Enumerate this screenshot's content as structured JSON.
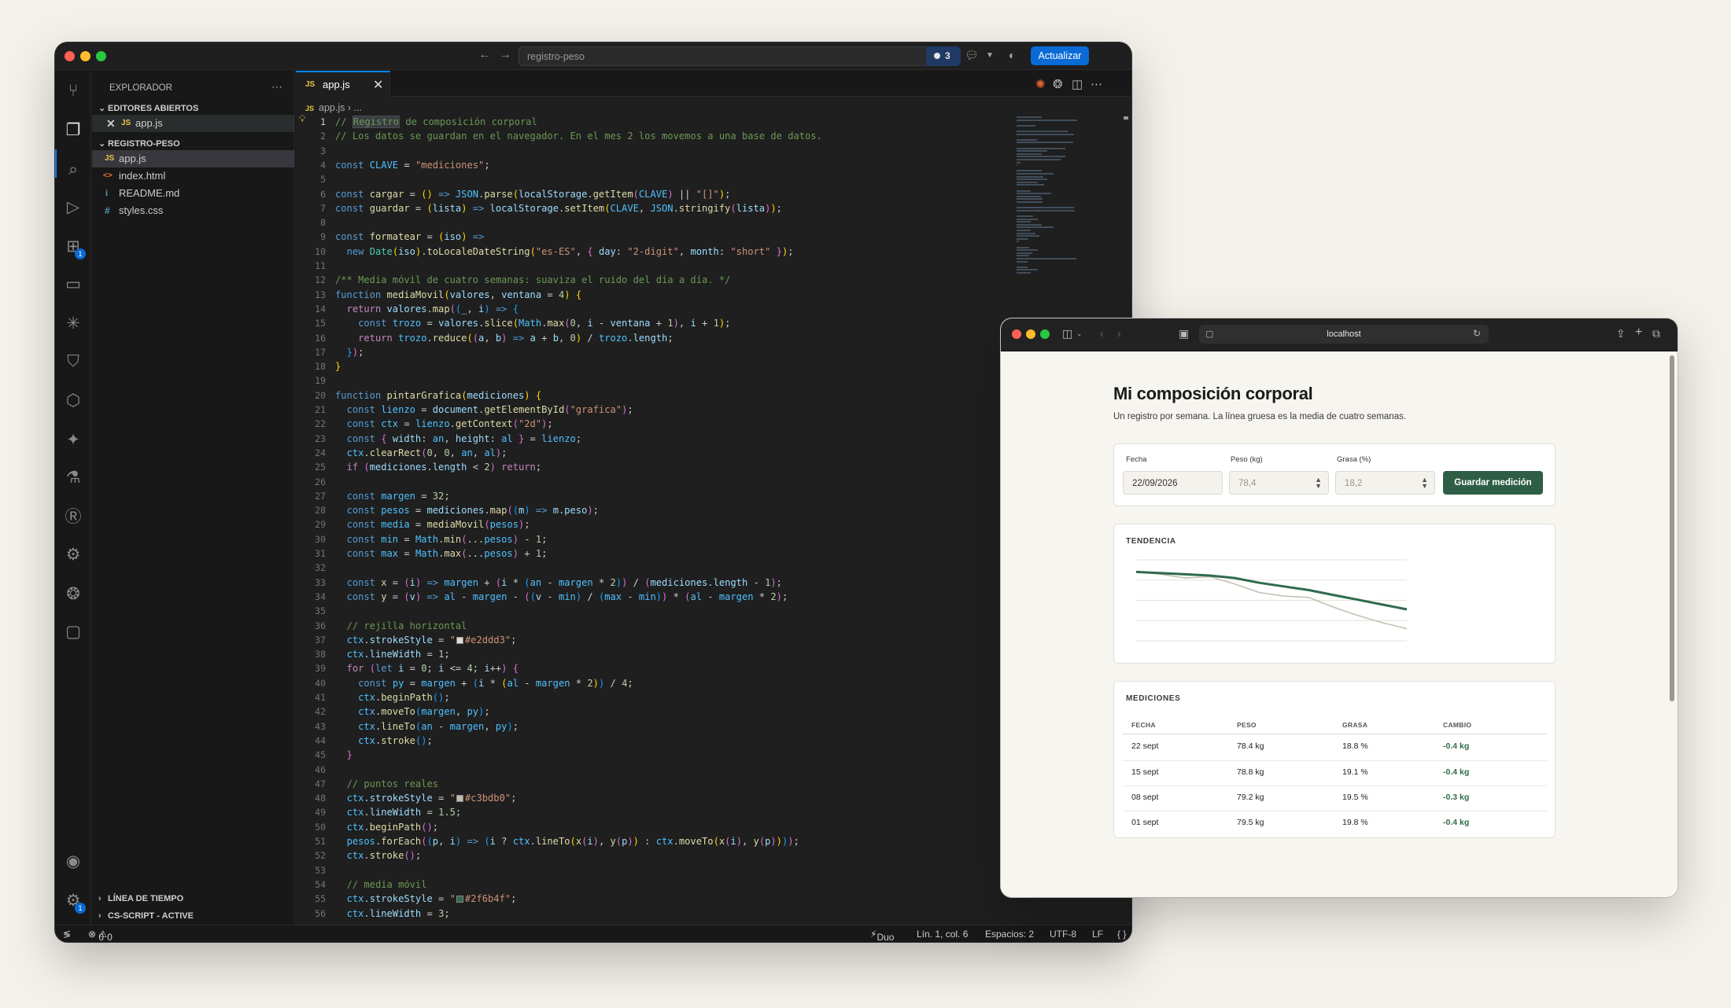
{
  "vscode": {
    "search": "registro-peso",
    "badge_count": "3",
    "update_label": "Actualizar",
    "activity_badges": [
      "1",
      "1"
    ],
    "explorer": {
      "title": "EXPLORADOR",
      "open_editors_label": "EDITORES ABIERTOS",
      "open_editors": [
        {
          "icon": "JS",
          "name": "app.js"
        }
      ],
      "folder_label": "REGISTRO-PESO",
      "files": [
        {
          "icon": "JS",
          "name": "app.js",
          "color": "#e8c547"
        },
        {
          "icon": "<>",
          "name": "index.html",
          "color": "#e37933"
        },
        {
          "icon": "i",
          "name": "README.md",
          "color": "#519aba"
        },
        {
          "icon": "#",
          "name": "styles.css",
          "color": "#519aba"
        }
      ],
      "timeline_label": "LÍNEA DE TIEMPO",
      "cs_label": "CS-SCRIPT - ACTIVE"
    },
    "tab": {
      "icon": "JS",
      "name": "app.js"
    },
    "breadcrumb": {
      "file": "app.js",
      "rest": "..."
    },
    "status": {
      "errors": "0",
      "warnings": "0",
      "copilot": "Duo",
      "position": "Lín. 1, col. 6",
      "spaces": "Espacios: 2",
      "encoding": "UTF-8",
      "eol": "LF",
      "lang": "{ }"
    },
    "current_line": 1,
    "code_lines": [
      "<span class=\"c\">// </span><span class=\"c hl\">Registro</span><span class=\"c\"> de composición corporal</span>",
      "<span class=\"c\">// Los datos se guardan en el navegador. En el mes 2 los movemos a una base de datos.</span>",
      "",
      "<span class=\"k\">const</span> <span class=\"cn\">CLAVE</span> <span class=\"p\">=</span> <span class=\"s\">\"mediciones\"</span>;",
      "",
      "<span class=\"k\">const</span> <span class=\"f\">cargar</span> = <span class=\"b1\">()</span> <span class=\"k\">=&gt;</span> <span class=\"cn\">JSON</span>.<span class=\"f\">parse</span><span class=\"b1\">(</span><span class=\"v\">localStorage</span>.<span class=\"f\">getItem</span><span class=\"b2\">(</span><span class=\"cn\">CLAVE</span><span class=\"b2\">)</span> || <span class=\"s\">\"[]\"</span><span class=\"b1\">)</span>;",
      "<span class=\"k\">const</span> <span class=\"f\">guardar</span> = <span class=\"b1\">(</span><span class=\"v\">lista</span><span class=\"b1\">)</span> <span class=\"k\">=&gt;</span> <span class=\"v\">localStorage</span>.<span class=\"f\">setItem</span><span class=\"b1\">(</span><span class=\"cn\">CLAVE</span>, <span class=\"cn\">JSON</span>.<span class=\"f\">stringify</span><span class=\"b2\">(</span><span class=\"v\">lista</span><span class=\"b2\">)</span><span class=\"b1\">)</span>;",
      "",
      "<span class=\"k\">const</span> <span class=\"f\">formatear</span> = <span class=\"b1\">(</span><span class=\"v\">iso</span><span class=\"b1\">)</span> <span class=\"k\">=&gt;</span>",
      "  <span class=\"k\">new</span> <span class=\"t\">Date</span><span class=\"b1\">(</span><span class=\"v\">iso</span><span class=\"b1\">)</span>.<span class=\"f\">toLocaleDateString</span><span class=\"b1\">(</span><span class=\"s\">\"es-ES\"</span>, <span class=\"b2\">{</span> <span class=\"v\">day</span>: <span class=\"s\">\"2-digit\"</span>, <span class=\"v\">month</span>: <span class=\"s\">\"short\"</span> <span class=\"b2\">}</span><span class=\"b1\">)</span>;",
      "",
      "<span class=\"c\">/** Media móvil de cuatro semanas: suaviza el ruido del día a día. */</span>",
      "<span class=\"k\">function</span> <span class=\"f\">mediaMovil</span><span class=\"b1\">(</span><span class=\"v\">valores</span>, <span class=\"v\">ventana</span> = <span class=\"n\">4</span><span class=\"b1\">)</span> <span class=\"b1\">{</span>",
      "  <span class=\"kc\">return</span> <span class=\"v\">valores</span>.<span class=\"f\">map</span><span class=\"b2\">(</span><span class=\"b3\">(</span><span class=\"v\">_</span>, <span class=\"v\">i</span><span class=\"b3\">)</span> <span class=\"k\">=&gt;</span> <span class=\"b3\">{</span>",
      "    <span class=\"k\">const</span> <span class=\"cn\">trozo</span> = <span class=\"v\">valores</span>.<span class=\"f\">slice</span><span class=\"b1\">(</span><span class=\"cn\">Math</span>.<span class=\"f\">max</span><span class=\"b2\">(</span><span class=\"n\">0</span>, <span class=\"v\">i</span> - <span class=\"v\">ventana</span> + <span class=\"n\">1</span><span class=\"b2\">)</span>, <span class=\"v\">i</span> + <span class=\"n\">1</span><span class=\"b1\">)</span>;",
      "    <span class=\"kc\">return</span> <span class=\"cn\">trozo</span>.<span class=\"f\">reduce</span><span class=\"b1\">(</span><span class=\"b2\">(</span><span class=\"v\">a</span>, <span class=\"v\">b</span><span class=\"b2\">)</span> <span class=\"k\">=&gt;</span> <span class=\"v\">a</span> + <span class=\"v\">b</span>, <span class=\"n\">0</span><span class=\"b1\">)</span> / <span class=\"cn\">trozo</span>.<span class=\"v\">length</span>;",
      "  <span class=\"b3\">}</span><span class=\"b2\">)</span>;",
      "<span class=\"b1\">}</span>",
      "",
      "<span class=\"k\">function</span> <span class=\"f\">pintarGrafica</span><span class=\"b1\">(</span><span class=\"v\">mediciones</span><span class=\"b1\">)</span> <span class=\"b1\">{</span>",
      "  <span class=\"k\">const</span> <span class=\"cn\">lienzo</span> = <span class=\"v\">document</span>.<span class=\"f\">getElementById</span><span class=\"b2\">(</span><span class=\"s\">\"grafica\"</span><span class=\"b2\">)</span>;",
      "  <span class=\"k\">const</span> <span class=\"cn\">ctx</span> = <span class=\"cn\">lienzo</span>.<span class=\"f\">getContext</span><span class=\"b2\">(</span><span class=\"s\">\"2d\"</span><span class=\"b2\">)</span>;",
      "  <span class=\"k\">const</span> <span class=\"b2\">{</span> <span class=\"v\">width</span>: <span class=\"cn\">an</span>, <span class=\"v\">height</span>: <span class=\"cn\">al</span> <span class=\"b2\">}</span> = <span class=\"cn\">lienzo</span>;",
      "  <span class=\"cn\">ctx</span>.<span class=\"f\">clearRect</span><span class=\"b2\">(</span><span class=\"n\">0</span>, <span class=\"n\">0</span>, <span class=\"cn\">an</span>, <span class=\"cn\">al</span><span class=\"b2\">)</span>;",
      "  <span class=\"kc\">if</span> <span class=\"b2\">(</span><span class=\"v\">mediciones</span>.<span class=\"v\">length</span> &lt; <span class=\"n\">2</span><span class=\"b2\">)</span> <span class=\"kc\">return</span>;",
      "",
      "  <span class=\"k\">const</span> <span class=\"cn\">margen</span> = <span class=\"n\">32</span>;",
      "  <span class=\"k\">const</span> <span class=\"cn\">pesos</span> = <span class=\"v\">mediciones</span>.<span class=\"f\">map</span><span class=\"b2\">(</span><span class=\"b3\">(</span><span class=\"v\">m</span><span class=\"b3\">)</span> <span class=\"k\">=&gt;</span> <span class=\"v\">m</span>.<span class=\"v\">peso</span><span class=\"b2\">)</span>;",
      "  <span class=\"k\">const</span> <span class=\"cn\">media</span> = <span class=\"f\">mediaMovil</span><span class=\"b2\">(</span><span class=\"cn\">pesos</span><span class=\"b2\">)</span>;",
      "  <span class=\"k\">const</span> <span class=\"cn\">min</span> = <span class=\"cn\">Math</span>.<span class=\"f\">min</span><span class=\"b2\">(</span>...<span class=\"cn\">pesos</span><span class=\"b2\">)</span> - <span class=\"n\">1</span>;",
      "  <span class=\"k\">const</span> <span class=\"cn\">max</span> = <span class=\"cn\">Math</span>.<span class=\"f\">max</span><span class=\"b2\">(</span>...<span class=\"cn\">pesos</span><span class=\"b2\">)</span> + <span class=\"n\">1</span>;",
      "",
      "  <span class=\"k\">const</span> <span class=\"f\">x</span> = <span class=\"b2\">(</span><span class=\"v\">i</span><span class=\"b2\">)</span> <span class=\"k\">=&gt;</span> <span class=\"cn\">margen</span> + <span class=\"b2\">(</span><span class=\"v\">i</span> * <span class=\"b3\">(</span><span class=\"cn\">an</span> - <span class=\"cn\">margen</span> * <span class=\"n\">2</span><span class=\"b3\">)</span><span class=\"b2\">)</span> / <span class=\"b2\">(</span><span class=\"v\">mediciones</span>.<span class=\"v\">length</span> - <span class=\"n\">1</span><span class=\"b2\">)</span>;",
      "  <span class=\"k\">const</span> <span class=\"f\">y</span> = <span class=\"b2\">(</span><span class=\"v\">v</span><span class=\"b2\">)</span> <span class=\"k\">=&gt;</span> <span class=\"cn\">al</span> - <span class=\"cn\">margen</span> - <span class=\"b2\">(</span><span class=\"b3\">(</span><span class=\"v\">v</span> - <span class=\"cn\">min</span><span class=\"b3\">)</span> / <span class=\"b3\">(</span><span class=\"cn\">max</span> - <span class=\"cn\">min</span><span class=\"b3\">)</span><span class=\"b2\">)</span> * <span class=\"b2\">(</span><span class=\"cn\">al</span> - <span class=\"cn\">margen</span> * <span class=\"n\">2</span><span class=\"b2\">)</span>;",
      "",
      "  <span class=\"c\">// rejilla horizontal</span>",
      "  <span class=\"cn\">ctx</span>.<span class=\"v\">strokeStyle</span> = <span class=\"s\">\"<span class=\"sw\" style=\"background:#e2ddd3\"></span>#e2ddd3\"</span>;",
      "  <span class=\"cn\">ctx</span>.<span class=\"v\">lineWidth</span> = <span class=\"n\">1</span>;",
      "  <span class=\"kc\">for</span> <span class=\"b2\">(</span><span class=\"k\">let</span> <span class=\"v\">i</span> = <span class=\"n\">0</span>; <span class=\"v\">i</span> &lt;= <span class=\"n\">4</span>; <span class=\"v\">i</span>++<span class=\"b2\">)</span> <span class=\"b2\">{</span>",
      "    <span class=\"k\">const</span> <span class=\"cn\">py</span> = <span class=\"cn\">margen</span> + <span class=\"b3\">(</span><span class=\"v\">i</span> * <span class=\"b1\">(</span><span class=\"cn\">al</span> - <span class=\"cn\">margen</span> * <span class=\"n\">2</span><span class=\"b1\">)</span><span class=\"b3\">)</span> / <span class=\"n\">4</span>;",
      "    <span class=\"cn\">ctx</span>.<span class=\"f\">beginPath</span><span class=\"b3\">()</span>;",
      "    <span class=\"cn\">ctx</span>.<span class=\"f\">moveTo</span><span class=\"b3\">(</span><span class=\"cn\">margen</span>, <span class=\"cn\">py</span><span class=\"b3\">)</span>;",
      "    <span class=\"cn\">ctx</span>.<span class=\"f\">lineTo</span><span class=\"b3\">(</span><span class=\"cn\">an</span> - <span class=\"cn\">margen</span>, <span class=\"cn\">py</span><span class=\"b3\">)</span>;",
      "    <span class=\"cn\">ctx</span>.<span class=\"f\">stroke</span><span class=\"b3\">()</span>;",
      "  <span class=\"b2\">}</span>",
      "",
      "  <span class=\"c\">// puntos reales</span>",
      "  <span class=\"cn\">ctx</span>.<span class=\"v\">strokeStyle</span> = <span class=\"s\">\"<span class=\"sw\" style=\"background:#c3bdb0\"></span>#c3bdb0\"</span>;",
      "  <span class=\"cn\">ctx</span>.<span class=\"v\">lineWidth</span> = <span class=\"n\">1.5</span>;",
      "  <span class=\"cn\">ctx</span>.<span class=\"f\">beginPath</span><span class=\"b2\">()</span>;",
      "  <span class=\"cn\">pesos</span>.<span class=\"f\">forEach</span><span class=\"b2\">(</span><span class=\"b3\">(</span><span class=\"v\">p</span>, <span class=\"v\">i</span><span class=\"b3\">)</span> <span class=\"k\">=&gt;</span> <span class=\"b3\">(</span><span class=\"v\">i</span> ? <span class=\"cn\">ctx</span>.<span class=\"f\">lineTo</span><span class=\"b1\">(</span><span class=\"f\">x</span><span class=\"b2\">(</span><span class=\"v\">i</span><span class=\"b2\">)</span>, <span class=\"f\">y</span><span class=\"b2\">(</span><span class=\"v\">p</span><span class=\"b2\">)</span><span class=\"b1\">)</span> : <span class=\"cn\">ctx</span>.<span class=\"f\">moveTo</span><span class=\"b1\">(</span><span class=\"f\">x</span><span class=\"b2\">(</span><span class=\"v\">i</span><span class=\"b2\">)</span>, <span class=\"f\">y</span><span class=\"b2\">(</span><span class=\"v\">p</span><span class=\"b2\">)</span><span class=\"b1\">)</span><span class=\"b3\">)</span><span class=\"b2\">)</span>;",
      "  <span class=\"cn\">ctx</span>.<span class=\"f\">stroke</span><span class=\"b2\">()</span>;",
      "",
      "  <span class=\"c\">// media móvil</span>",
      "  <span class=\"cn\">ctx</span>.<span class=\"v\">strokeStyle</span> = <span class=\"s\">\"<span class=\"sw\" style=\"background:#2f6b4f\"></span>#2f6b4f\"</span>;",
      "  <span class=\"cn\">ctx</span>.<span class=\"v\">lineWidth</span> = <span class=\"n\">3</span>;"
    ]
  },
  "browser": {
    "url": "localhost",
    "title": "Mi composición corporal",
    "subtitle": "Un registro por semana. La línea gruesa es la media de cuatro semanas.",
    "form": {
      "date_label": "Fecha",
      "date_value": "22/09/2026",
      "weight_label": "Peso (kg)",
      "weight_placeholder": "78,4",
      "fat_label": "Grasa (%)",
      "fat_placeholder": "18,2",
      "save_label": "Guardar medición"
    },
    "trend_title": "TENDENCIA",
    "table_title": "MEDICIONES",
    "columns": [
      "FECHA",
      "PESO",
      "GRASA",
      "CAMBIO"
    ],
    "rows": [
      [
        "22 sept",
        "78.4 kg",
        "18.8 %",
        "-0.4 kg"
      ],
      [
        "15 sept",
        "78.8 kg",
        "19.1 %",
        "-0.4 kg"
      ],
      [
        "08 sept",
        "79.2 kg",
        "19.5 %",
        "-0.3 kg"
      ],
      [
        "01 sept",
        "79.5 kg",
        "19.8 %",
        "-0.4 kg"
      ]
    ]
  },
  "chart_data": {
    "type": "line",
    "title": "TENDENCIA",
    "grid": true,
    "gridlines": 5,
    "series": [
      {
        "values": [
          83.1,
          82.9,
          82.6,
          82.7,
          82.1,
          81.4,
          81.1,
          81.0,
          80.2,
          79.5,
          78.9,
          78.4
        ],
        "color": "#c3bdb0"
      },
      {
        "values": [
          83.1,
          83.0,
          82.9,
          82.8,
          82.6,
          82.2,
          81.9,
          81.6,
          81.2,
          80.8,
          80.4,
          80.0
        ],
        "color": "#2f6b4f"
      }
    ],
    "ylim": [
      77.4,
      84.1
    ]
  }
}
